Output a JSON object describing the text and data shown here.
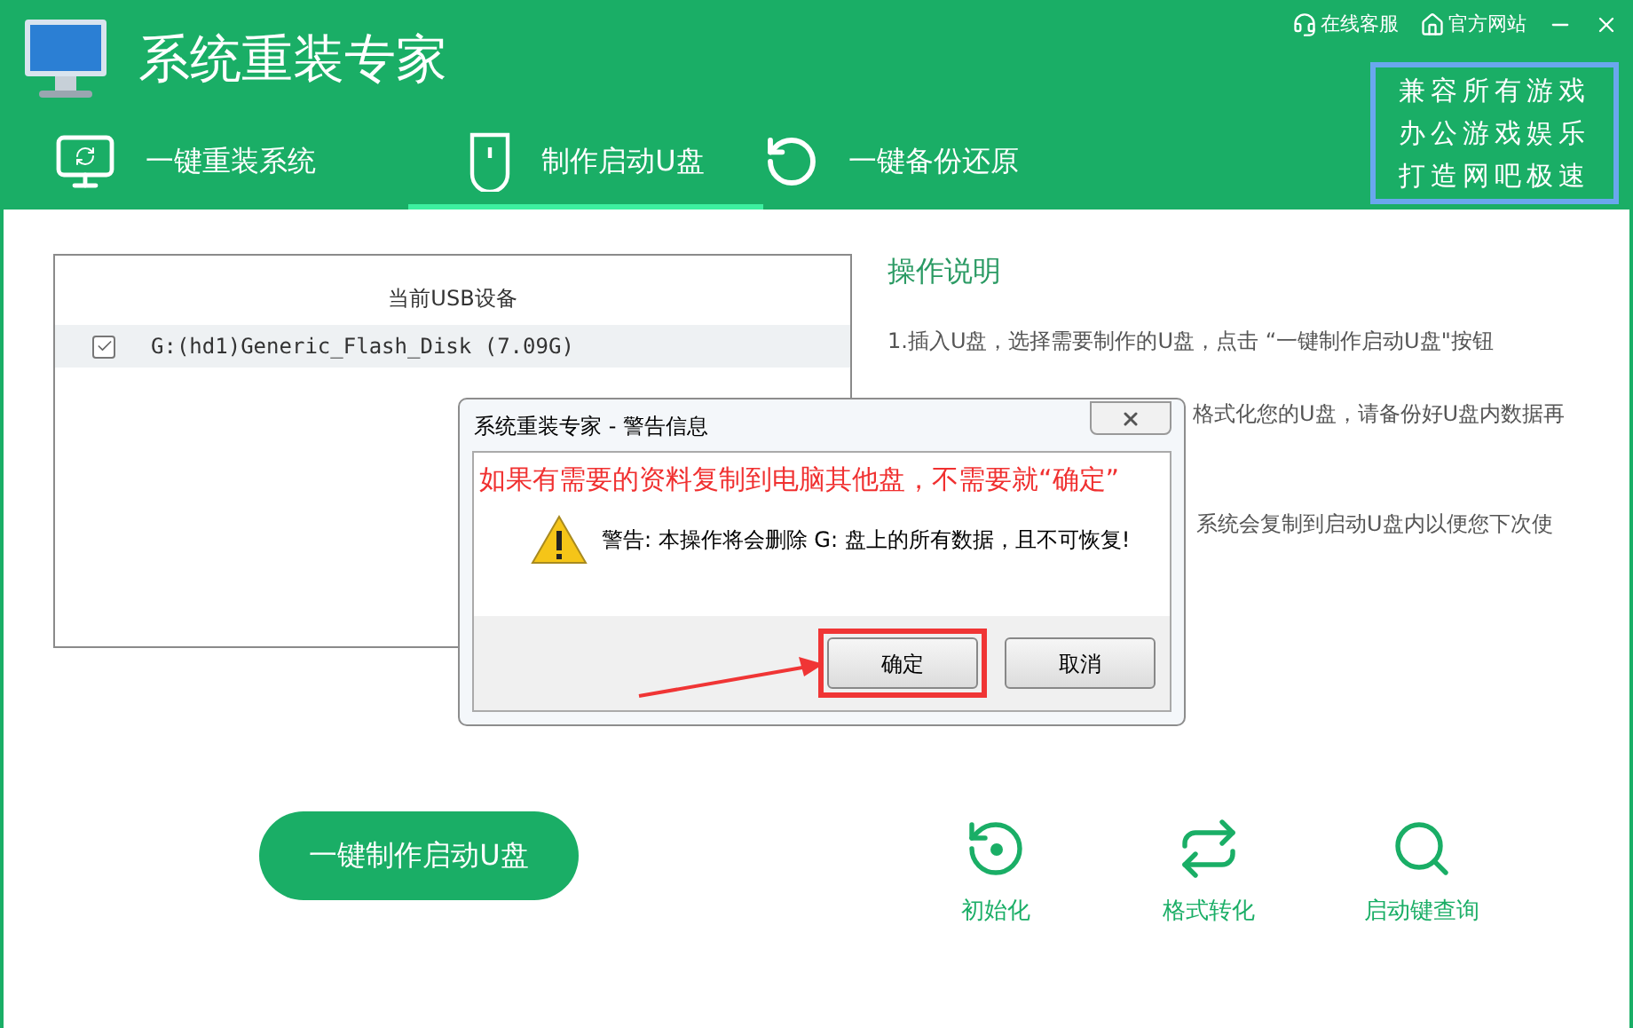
{
  "app": {
    "title": "系统重装专家",
    "links": [
      {
        "kind": "support",
        "label": "在线客服"
      },
      {
        "kind": "website",
        "label": "官方网站"
      }
    ],
    "badge_lines": [
      "兼容所有游戏",
      "办公游戏娱乐",
      "打造网吧极速"
    ]
  },
  "tabs": [
    {
      "kind": "monitor",
      "label": "一键重装系统",
      "selected": false
    },
    {
      "kind": "usb",
      "label": "制作启动U盘",
      "selected": true
    },
    {
      "kind": "restore",
      "label": "一键备份还原",
      "selected": false
    }
  ],
  "device_panel": {
    "title": "当前USB设备",
    "devices": [
      {
        "label": "G:(hd1)Generic_Flash_Disk (7.09G)",
        "checked": true,
        "selected": true
      }
    ]
  },
  "instructions": {
    "title": "操作说明",
    "steps": [
      "1.插入U盘，选择需要制作的U盘，点击 “一键制作启动U盘\"按钮",
      "格式化您的U盘，请备份好U盘内数据再",
      "系统会复制到启动U盘内以便您下次使"
    ]
  },
  "dialog": {
    "title": "系统重装专家 - 警告信息",
    "note": "如果有需要的资料复制到电脑其他盘，不需要就“确定”",
    "message": "警告: 本操作将会删除 G: 盘上的所有数据，且不可恢复!",
    "buttons": [
      {
        "label": "确定",
        "highlighted": true
      },
      {
        "label": "取消",
        "highlighted": false
      }
    ]
  },
  "primary_button": "一键制作启动U盘",
  "tools": [
    {
      "kind": "reset",
      "label": "初始化"
    },
    {
      "kind": "convert",
      "label": "格式转化"
    },
    {
      "kind": "search",
      "label": "启动键查询"
    }
  ]
}
